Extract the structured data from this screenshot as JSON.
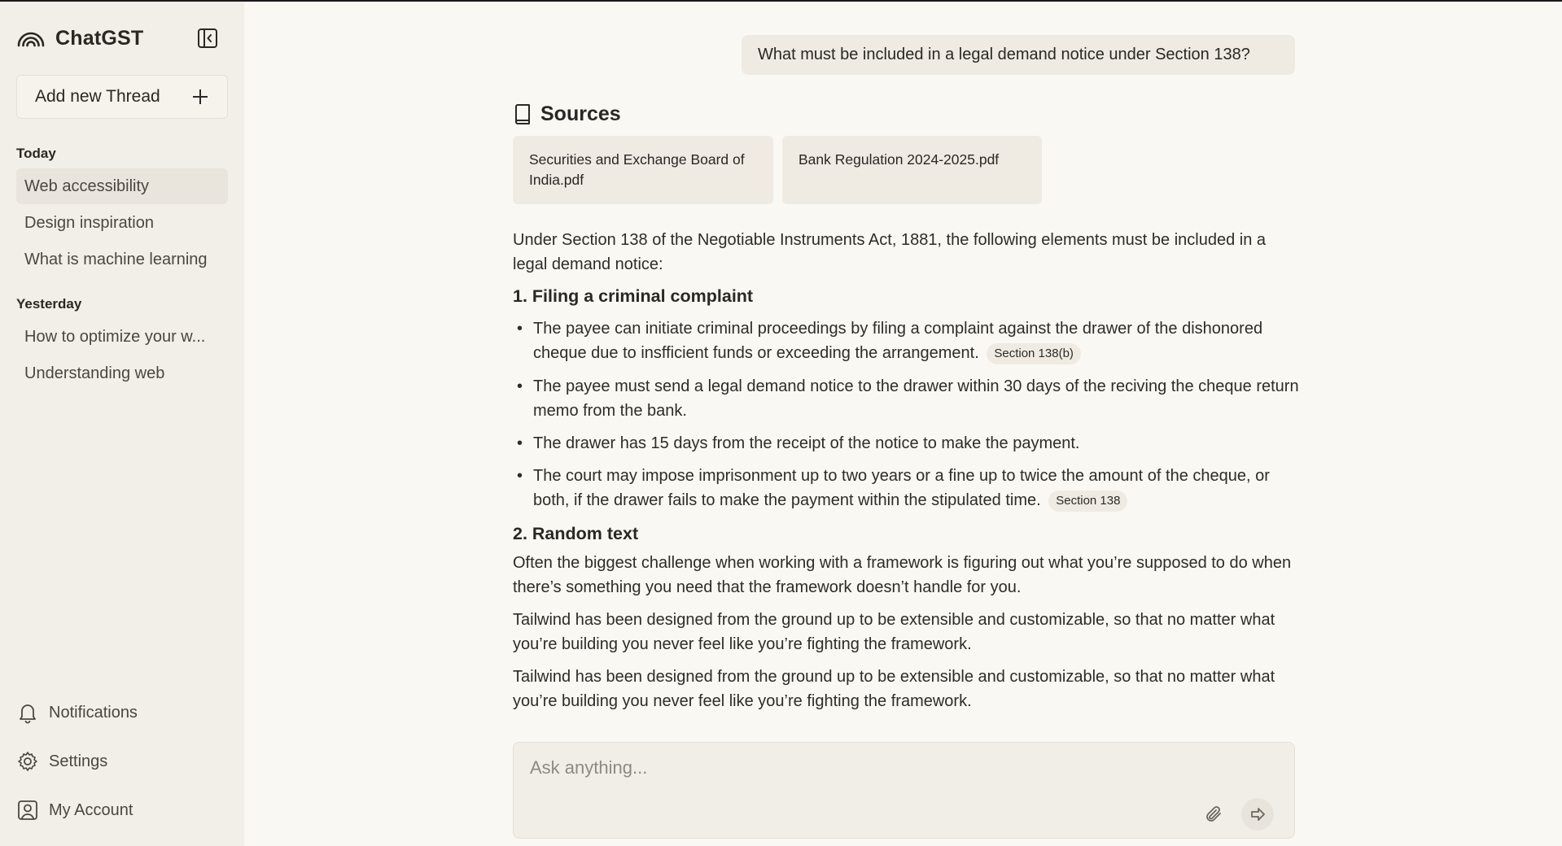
{
  "app": {
    "name": "ChatGST"
  },
  "sidebar": {
    "new_thread_label": "Add new Thread",
    "groups": [
      {
        "title": "Today",
        "items": [
          {
            "label": "Web accessibility",
            "active": true
          },
          {
            "label": "Design inspiration"
          },
          {
            "label": "What is machine learning"
          }
        ]
      },
      {
        "title": "Yesterday",
        "items": [
          {
            "label": "How to optimize your w..."
          },
          {
            "label": "Understanding web"
          }
        ]
      }
    ],
    "bottom": {
      "notifications": "Notifications",
      "settings": "Settings",
      "account": "My Account"
    }
  },
  "conversation": {
    "user_message": "What must be included in a legal demand notice under Section 138?",
    "sources_title": "Sources",
    "sources": [
      {
        "name": "Securities and Exchange Board of India.pdf"
      },
      {
        "name": "Bank Regulation 2024-2025.pdf"
      }
    ],
    "intro": "Under Section 138 of the Negotiable Instruments Act, 1881, the following elements must be included in a legal demand notice:",
    "section1": {
      "heading": "1. Filing a criminal complaint",
      "bullets": [
        {
          "text": "The payee can initiate criminal proceedings by filing a complaint against the drawer of the dishonored cheque due to insfficient funds or exceeding the arrangement.",
          "chip": "Section 138(b)"
        },
        {
          "text": "The payee must send a legal demand notice to the drawer within 30 days of the reciving the cheque return memo from the bank."
        },
        {
          "text": "The drawer has 15 days from the receipt of the notice to make the payment."
        },
        {
          "text": "The court may impose imprisonment up to two years or a fine up to twice the amount of the cheque, or both, if the drawer fails to make the payment within the stipulated time.",
          "chip": "Section 138"
        }
      ]
    },
    "section2": {
      "heading": "2. Random text",
      "paragraphs": [
        "Often the biggest challenge when working with a framework is figuring out what you’re supposed to do when there’s something you need that the framework doesn’t handle for you.",
        "Tailwind has been designed from the ground up to be extensible and customizable, so that no matter what you’re building you never feel like you’re fighting the framework.",
        "Tailwind has been designed from the ground up to be extensible and customizable, so that no matter what you’re building you never feel like you’re fighting the framework."
      ]
    }
  },
  "composer": {
    "placeholder": "Ask anything..."
  },
  "icons": {
    "logo": "rainbow-arcs-icon",
    "collapse": "sidebar-collapse-icon",
    "plus": "plus-icon",
    "sources": "book-icon",
    "notifications": "bell-icon",
    "settings": "gear-icon",
    "account": "user-square-icon",
    "attach": "paperclip-icon",
    "send": "forward-arrow-icon"
  }
}
